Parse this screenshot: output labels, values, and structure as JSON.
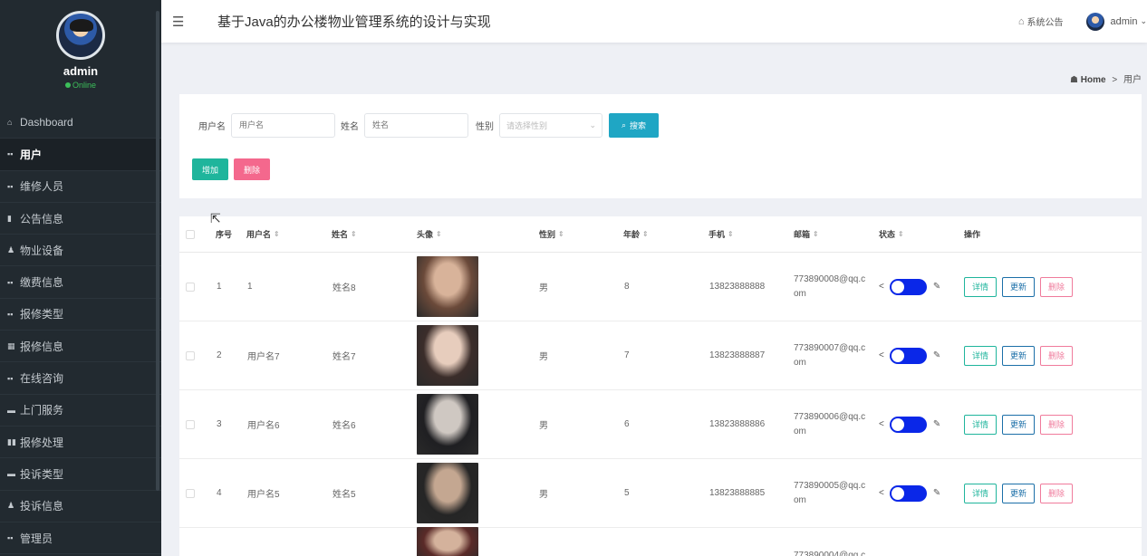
{
  "sidebar": {
    "username": "admin",
    "status": "Online",
    "items": [
      {
        "label": "Dashboard",
        "icon": "⌂"
      },
      {
        "label": "用户",
        "icon": "▪▪"
      },
      {
        "label": "维修人员",
        "icon": "▪▪"
      },
      {
        "label": "公告信息",
        "icon": "▮"
      },
      {
        "label": "物业设备",
        "icon": "♟"
      },
      {
        "label": "缴费信息",
        "icon": "▪▪"
      },
      {
        "label": "报修类型",
        "icon": "▪▪"
      },
      {
        "label": "报修信息",
        "icon": "▦"
      },
      {
        "label": "在线咨询",
        "icon": "▪▪"
      },
      {
        "label": "上门服务",
        "icon": "▬"
      },
      {
        "label": "报修处理",
        "icon": "▮▮"
      },
      {
        "label": "投诉类型",
        "icon": "▬"
      },
      {
        "label": "投诉信息",
        "icon": "♟"
      },
      {
        "label": "管理员",
        "icon": "▪▪"
      }
    ]
  },
  "header": {
    "menu_icon": "☰",
    "title": "基于Java的办公楼物业管理系统的设计与实现",
    "notice_label": "系统公告",
    "user_name": "admin"
  },
  "breadcrumb": {
    "home": "Home",
    "separator": ">",
    "current": "用户"
  },
  "search": {
    "username_label": "用户名",
    "username_placeholder": "用户名",
    "name_label": "姓名",
    "name_placeholder": "姓名",
    "gender_label": "性别",
    "gender_placeholder": "请选择性别",
    "search_button": "搜索",
    "add_button": "增加",
    "delete_button": "删除"
  },
  "table": {
    "headers": {
      "index": "序号",
      "username": "用户名",
      "name": "姓名",
      "avatar": "头像",
      "gender": "性别",
      "age": "年龄",
      "phone": "手机",
      "email": "邮箱",
      "status": "状态",
      "actions": "操作"
    },
    "action_labels": {
      "detail": "详情",
      "update": "更新",
      "delete": "删除"
    },
    "rows": [
      {
        "index": "1",
        "username": "1",
        "name": "姓名8",
        "gender": "男",
        "age": "8",
        "phone": "13823888888",
        "email": "773890008@qq.com",
        "photo_colors": [
          "#d8b39a",
          "#6b4a3a"
        ]
      },
      {
        "index": "2",
        "username": "用户名7",
        "name": "姓名7",
        "gender": "男",
        "age": "7",
        "phone": "13823888887",
        "email": "773890007@qq.com",
        "photo_colors": [
          "#e7cdbd",
          "#3b2d2a"
        ]
      },
      {
        "index": "3",
        "username": "用户名6",
        "name": "姓名6",
        "gender": "男",
        "age": "6",
        "phone": "13823888886",
        "email": "773890006@qq.com",
        "photo_colors": [
          "#cfc8c2",
          "#1f1f22"
        ]
      },
      {
        "index": "4",
        "username": "用户名5",
        "name": "姓名5",
        "gender": "男",
        "age": "5",
        "phone": "13823888885",
        "email": "773890005@qq.com",
        "photo_colors": [
          "#c4a791",
          "#252525"
        ]
      },
      {
        "index": "",
        "username": "",
        "name": "",
        "gender": "",
        "age": "",
        "phone": "",
        "email": "773890004@qq.c",
        "photo_colors": [
          "#d4b29c",
          "#5a2a28"
        ]
      }
    ]
  }
}
